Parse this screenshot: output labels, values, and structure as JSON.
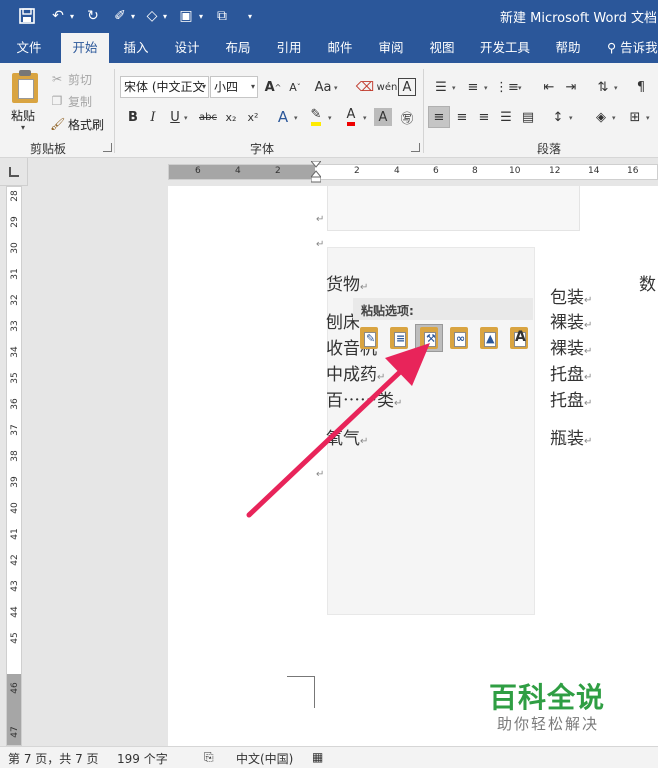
{
  "title_bar": {
    "title": "新建 Microsoft Word 文档.d",
    "qat": {
      "save_icon": "save-icon",
      "undo_icon": "undo-icon",
      "redo_icon": "redo-icon"
    },
    "colors": {
      "brand": "#2b579a"
    }
  },
  "tabs": [
    {
      "label": "文件"
    },
    {
      "label": "开始"
    },
    {
      "label": "插入"
    },
    {
      "label": "设计"
    },
    {
      "label": "布局"
    },
    {
      "label": "引用"
    },
    {
      "label": "邮件"
    },
    {
      "label": "审阅"
    },
    {
      "label": "视图"
    },
    {
      "label": "开发工具"
    },
    {
      "label": "帮助"
    }
  ],
  "tell_me": "告诉我",
  "ribbon": {
    "clipboard": {
      "paste_label": "粘贴",
      "cut_label": "剪切",
      "copy_label": "复制",
      "format_painter_label": "格式刷",
      "group_label": "剪贴板"
    },
    "font": {
      "font_name": "宋体 (中文正文",
      "font_size": "小四",
      "group_label": "字体",
      "wen_label": "wén",
      "aa_label": "Aa",
      "grow_label": "A^",
      "shrink_label": "Aˇ"
    },
    "paragraph": {
      "group_label": "段落"
    }
  },
  "ruler": {
    "h_left": [
      "6",
      "4",
      "2"
    ],
    "h_right": [
      "2",
      "4",
      "6",
      "8",
      "10",
      "12",
      "14",
      "16"
    ],
    "v": [
      "28",
      "29",
      "30",
      "31",
      "32",
      "33",
      "34",
      "35",
      "36",
      "37",
      "38",
      "39",
      "40",
      "41",
      "42",
      "43",
      "44",
      "45",
      "46",
      "47"
    ]
  },
  "document": {
    "para_mark": "↵",
    "left_col": [
      "货物",
      "刨床",
      "收音机",
      "中成药",
      "百⋯⋯类",
      "氧气"
    ],
    "right_col": [
      "包装",
      "裸装",
      "裸装",
      "托盘",
      "托盘",
      "瓶装"
    ],
    "far_right": "数"
  },
  "paste_options": {
    "label": "粘贴选项:",
    "buttons": [
      "keep-source-formatting",
      "merge-formatting",
      "use-destination-styles",
      "link-keep-source",
      "picture",
      "keep-text-only"
    ],
    "pressed_index": 2
  },
  "watermark": {
    "title": "百科全说",
    "subtitle": "助你轻松解决"
  },
  "status_bar": {
    "page": "第 7 页，共 7 页",
    "words": "199 个字",
    "language": "中文(中国)"
  }
}
